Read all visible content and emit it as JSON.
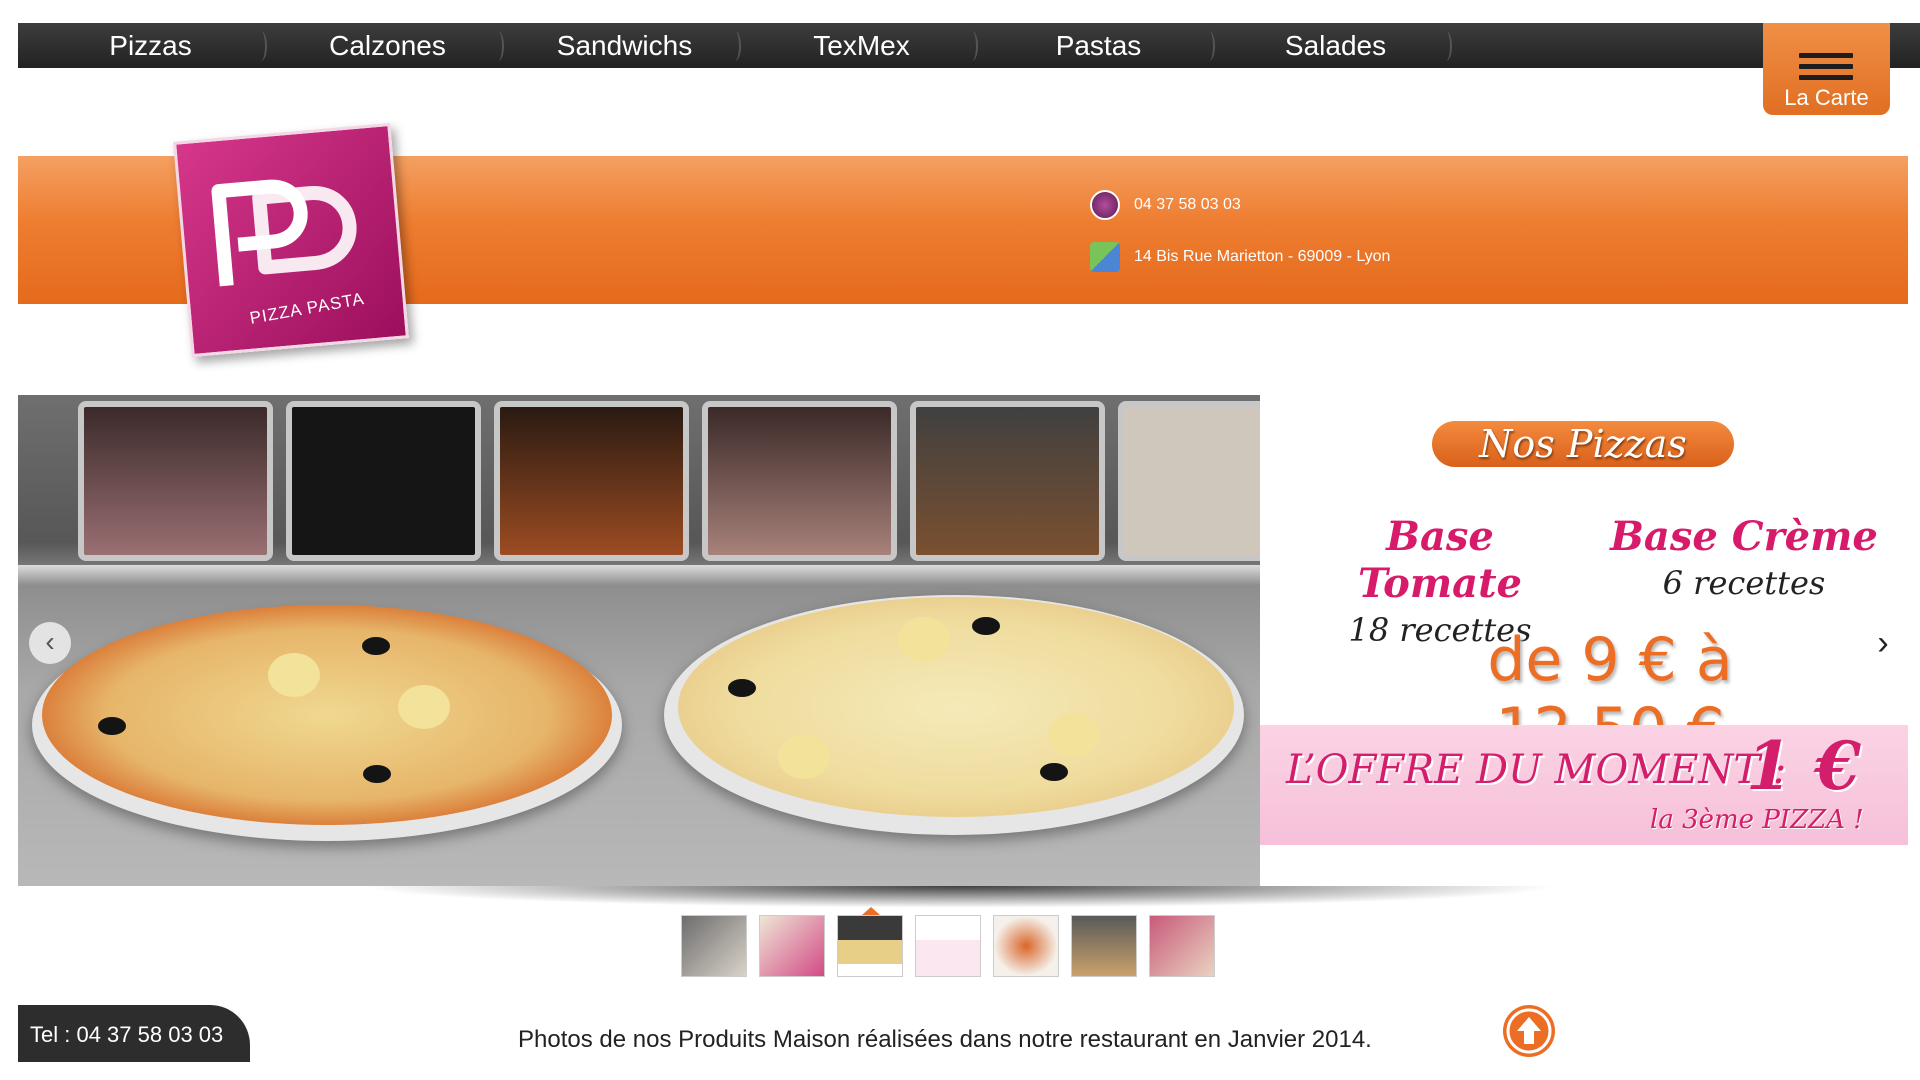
{
  "nav": {
    "items": [
      {
        "label": "Pizzas"
      },
      {
        "label": "Calzones"
      },
      {
        "label": "Sandwichs"
      },
      {
        "label": "TexMex"
      },
      {
        "label": "Pastas"
      },
      {
        "label": "Salades"
      }
    ],
    "carte_label": "La Carte",
    "menu_icon": "hamburger-icon"
  },
  "header": {
    "logo_text": "PIZZA PASTA",
    "phone": "04 37 58 03 03",
    "address": "14 Bis Rue Marietton - 69009 - Lyon",
    "phone_icon": "phone-icon",
    "map_icon": "map-icon"
  },
  "slider": {
    "promo_title": "Nos Pizzas",
    "bases": [
      {
        "title": "Base Tomate",
        "subtitle": "18 recettes"
      },
      {
        "title": "Base Crème",
        "subtitle": "6 recettes"
      }
    ],
    "price_range": "de 9 € à 12.50 €",
    "offer": {
      "label": "L’OFFRE DU MOMENT :",
      "price": "1 €",
      "detail": "la 3ème PIZZA !"
    },
    "prev_icon": "chevron-left-icon",
    "next_icon": "chevron-right-icon",
    "thumbnail_count": 7,
    "active_thumbnail": 3
  },
  "footer": {
    "tel": "Tel : 04 37 58 03 03",
    "caption": "Photos de nos Produits Maison réalisées dans notre restaurant en Janvier 2014.",
    "up_icon": "arrow-up-icon"
  },
  "colors": {
    "accent_orange": "#ec6e25",
    "brand_pink": "#d21e6b",
    "nav_dark": "#2d2d2d"
  }
}
